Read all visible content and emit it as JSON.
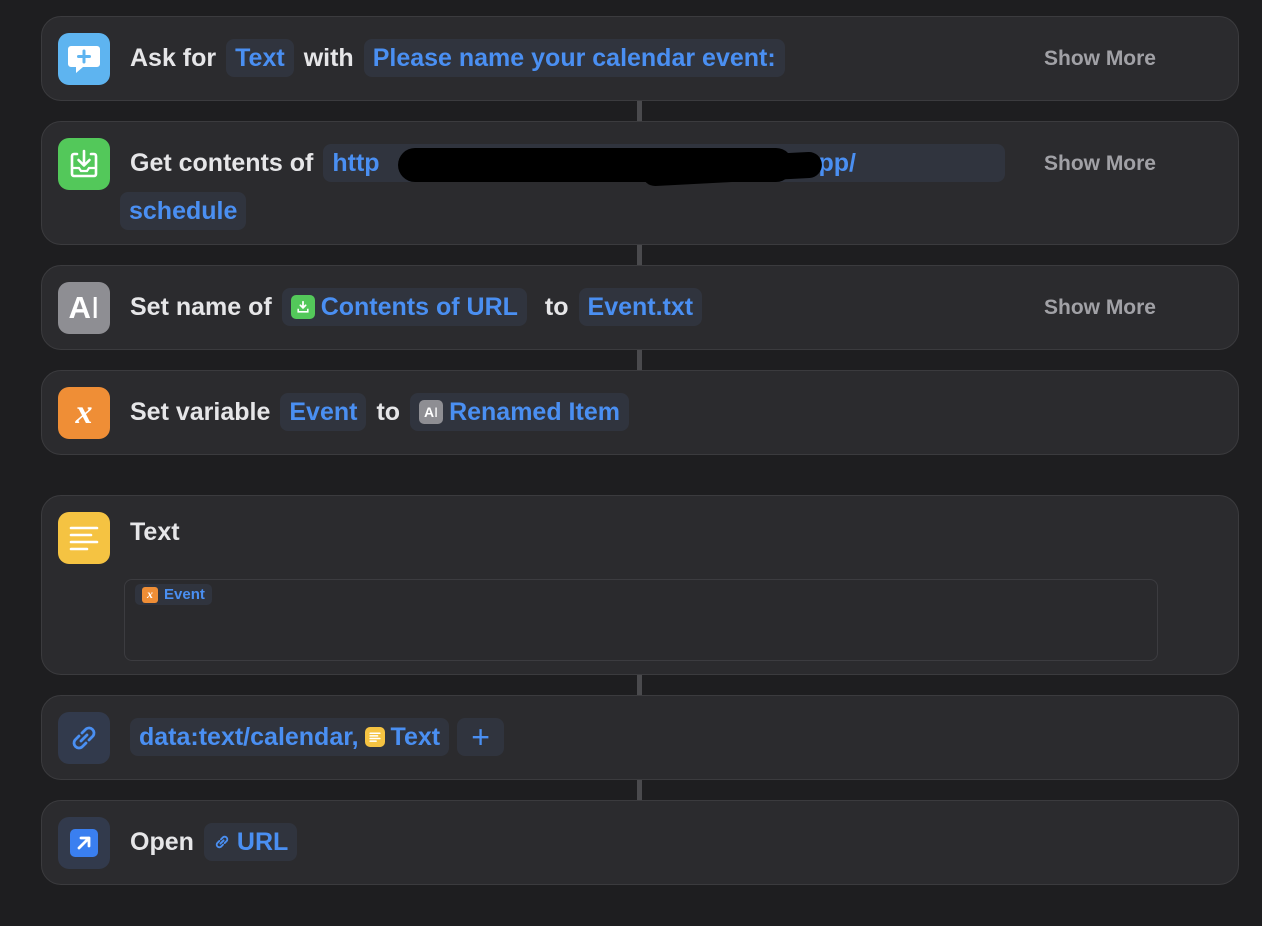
{
  "actions": {
    "ask": {
      "icon": "speech-bubble-plus-icon",
      "label_ask_for": "Ask for",
      "token_type": "Text",
      "label_with": "with",
      "token_prompt": "Please name your calendar event:",
      "show_more": "Show More"
    },
    "get_contents": {
      "icon": "download-tray-icon",
      "label": "Get contents of",
      "url_visible_start": "http",
      "url_visible_end": "run.app/",
      "url_line2": "schedule",
      "show_more": "Show More"
    },
    "set_name": {
      "icon": "text-cursor-icon",
      "label": "Set name of",
      "token_source": "Contents of URL",
      "label_to": "to",
      "token_name": "Event.txt",
      "show_more": "Show More"
    },
    "set_variable": {
      "icon": "variable-x-icon",
      "label": "Set variable",
      "token_var": "Event",
      "label_to": "to",
      "token_value": "Renamed Item"
    },
    "text": {
      "icon": "text-lines-icon",
      "label": "Text",
      "token_var": "Event"
    },
    "url": {
      "icon": "link-icon",
      "token_prefix": "data:text/calendar,",
      "token_text": "Text",
      "plus": "+"
    },
    "open": {
      "icon": "open-arrow-icon",
      "label": "Open",
      "token_url": "URL"
    }
  },
  "colors": {
    "background": "#1e1e20",
    "card": "#2b2b2e",
    "token_text": "#4a8ff2",
    "token_bg": "#30343e"
  }
}
